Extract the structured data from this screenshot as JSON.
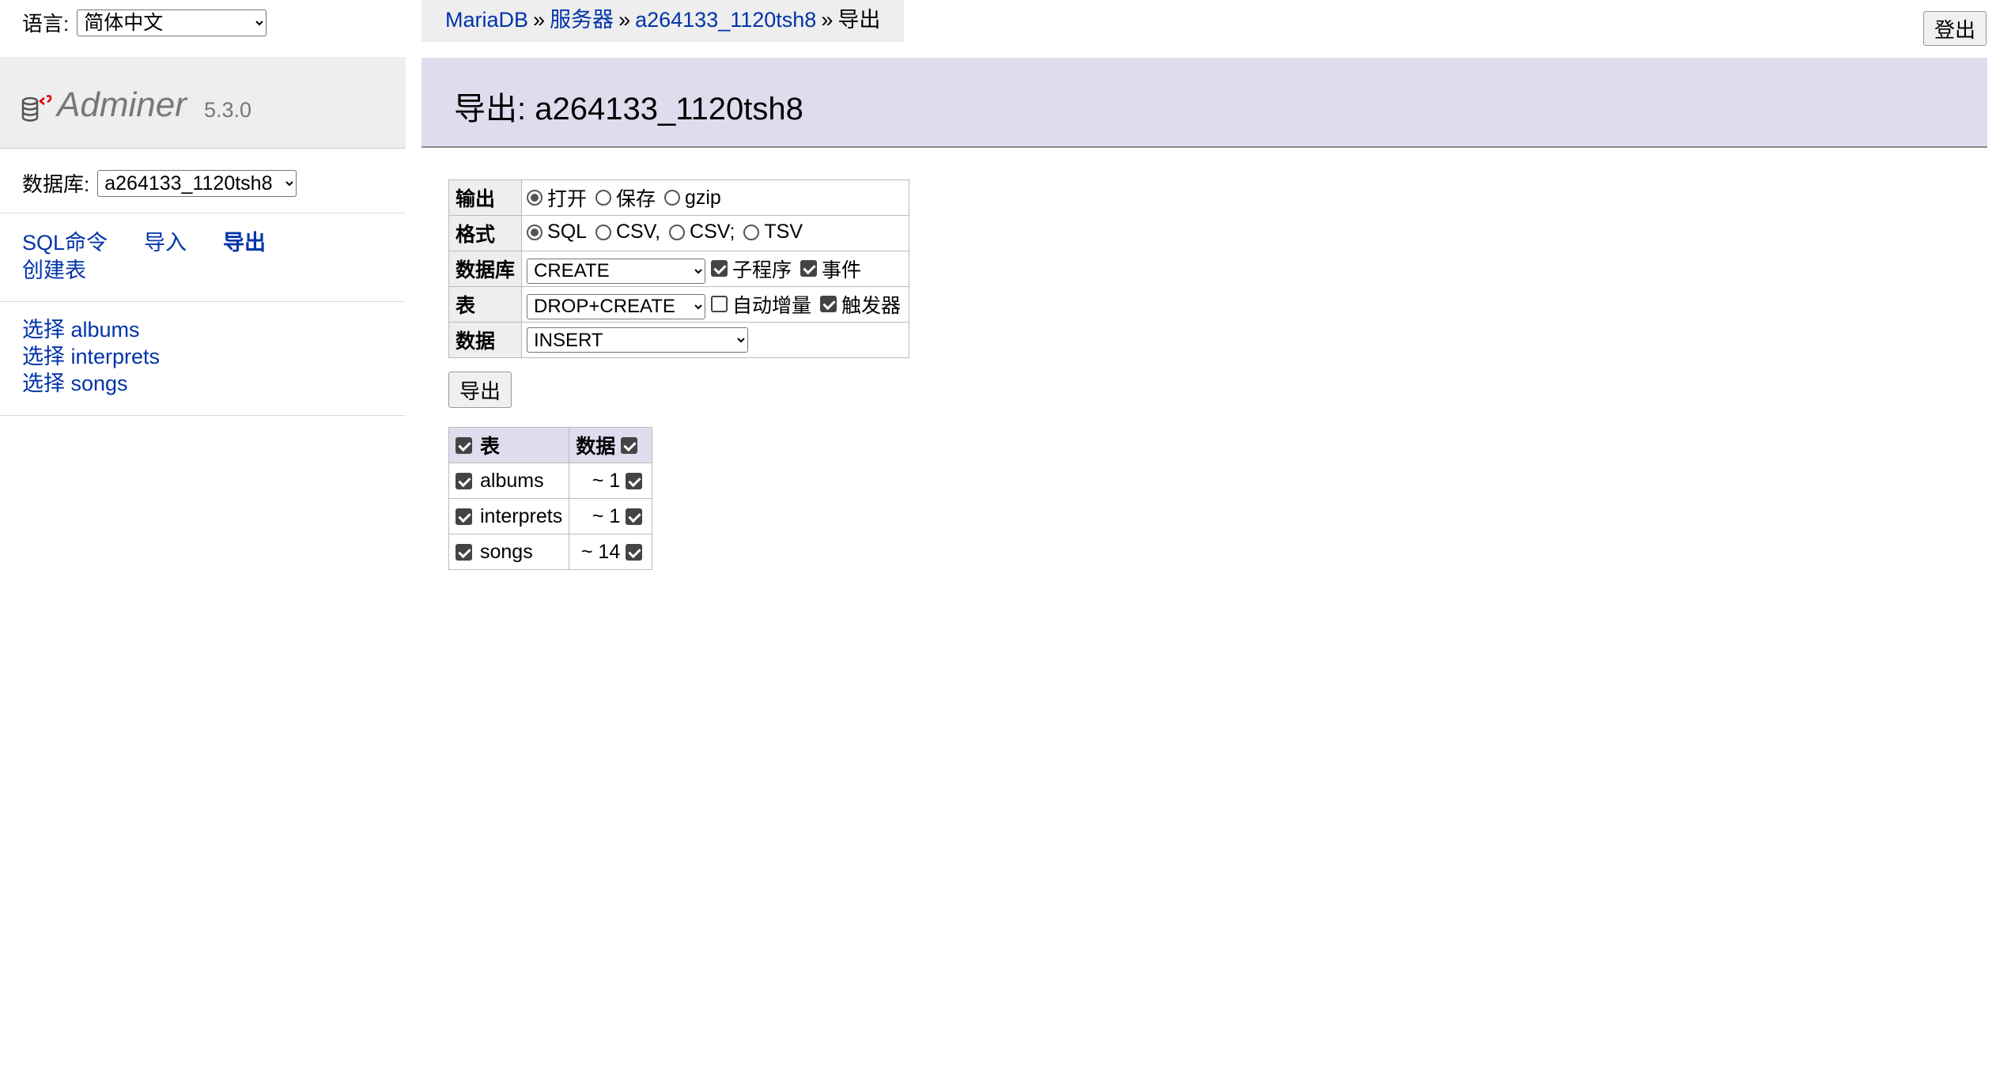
{
  "language": {
    "label": "语言:",
    "selected": "简体中文"
  },
  "brand": {
    "name": "Adminer",
    "version": "5.3.0"
  },
  "database": {
    "label": "数据库:",
    "selected": "a264133_1120tsh8"
  },
  "menu_links": {
    "sql": "SQL命令",
    "import": "导入",
    "export": "导出",
    "create_table": "创建表"
  },
  "menu_tables": [
    {
      "label": "选择 albums"
    },
    {
      "label": "选择 interprets"
    },
    {
      "label": "选择 songs"
    }
  ],
  "breadcrumb": {
    "server_type": "MariaDB",
    "server": "服务器",
    "db": "a264133_1120tsh8",
    "current": "导出",
    "sep": "»"
  },
  "logout_label": "登出",
  "page_title": "导出: a264133_1120tsh8",
  "options": {
    "output": {
      "label": "输出",
      "choices": [
        "打开",
        "保存",
        "gzip"
      ]
    },
    "format": {
      "label": "格式",
      "choices": [
        "SQL",
        "CSV,",
        "CSV;",
        "TSV"
      ]
    },
    "database": {
      "label": "数据库",
      "select": "CREATE",
      "check1": "子程序",
      "check2": "事件"
    },
    "table": {
      "label": "表",
      "select": "DROP+CREATE",
      "check1": "自动增量",
      "check2": "触发器"
    },
    "data": {
      "label": "数据",
      "select": "INSERT"
    }
  },
  "export_button": "导出",
  "tables_header": {
    "table": "表",
    "data": "数据"
  },
  "tables": [
    {
      "name": "albums",
      "rows": "~ 1"
    },
    {
      "name": "interprets",
      "rows": "~ 1"
    },
    {
      "name": "songs",
      "rows": "~ 14"
    }
  ]
}
